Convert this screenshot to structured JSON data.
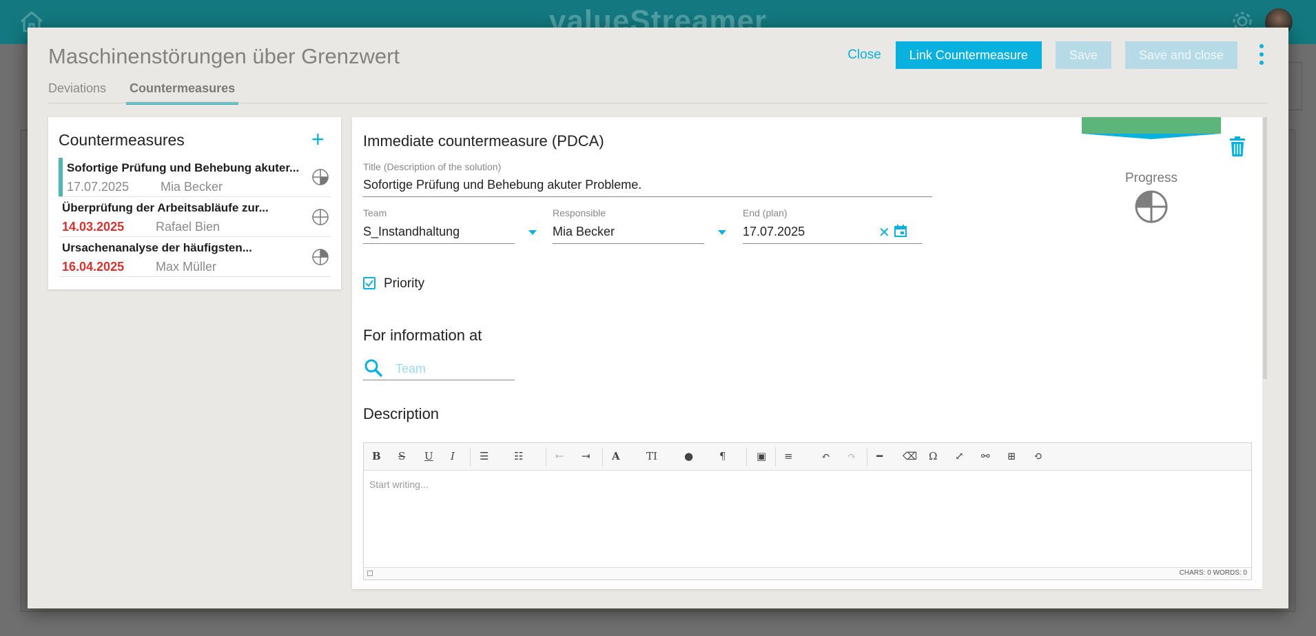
{
  "app": {
    "brand": "valueStreamer"
  },
  "modal": {
    "title": "Maschinenstörungen über Grenzwert",
    "close_label": "Close",
    "link_label": "Link Countermeasure",
    "save_label": "Save",
    "save_close_label": "Save and close"
  },
  "tabs": [
    {
      "label": "Deviations",
      "active": false
    },
    {
      "label": "Countermeasures",
      "active": true
    }
  ],
  "list": {
    "title": "Countermeasures",
    "items": [
      {
        "title": "Sofortige Prüfung und Behebung akuter...",
        "date": "17.07.2025",
        "person": "Mia Becker",
        "overdue": false,
        "selected": true
      },
      {
        "title": "Überprüfung der Arbeitsabläufe zur...",
        "date": "14.03.2025",
        "person": "Rafael Bien",
        "overdue": true,
        "selected": false
      },
      {
        "title": "Ursachenanalyse der häufigsten...",
        "date": "16.04.2025",
        "person": "Max Müller",
        "overdue": true,
        "selected": false
      }
    ]
  },
  "detail": {
    "heading": "Immediate countermeasure (PDCA)",
    "title_label": "Title (Description of the solution)",
    "title_value": "Sofortige Prüfung und Behebung akuter Probleme.",
    "team_label": "Team",
    "team_value": "S_Instandhaltung",
    "responsible_label": "Responsible",
    "responsible_value": "Mia Becker",
    "end_label": "End (plan)",
    "end_value": "17.07.2025",
    "priority_label": "Priority",
    "priority_checked": true,
    "info_heading": "For information at",
    "info_placeholder": "Team",
    "description_heading": "Description",
    "editor_placeholder": "Start writing...",
    "editor_counts": "CHARS: 0   WORDS: 0",
    "progress_label": "Progress"
  },
  "colors": {
    "accent": "#08b1de",
    "teal": "#41b2b5",
    "overdue": "#d7322d",
    "ribbon": "#5cb57b"
  }
}
